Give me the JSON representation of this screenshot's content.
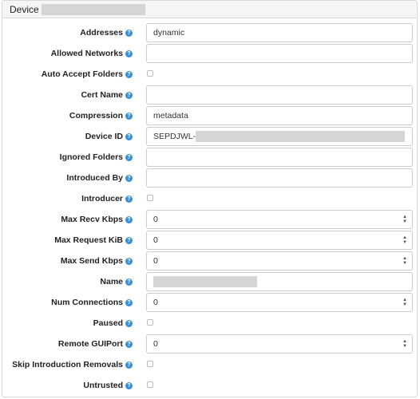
{
  "panel": {
    "title": "Device"
  },
  "rows": [
    {
      "label": "Addresses",
      "value": "dynamic"
    },
    {
      "label": "Allowed Networks",
      "value": ""
    },
    {
      "label": "Auto Accept Folders",
      "checked": false
    },
    {
      "label": "Cert Name",
      "value": ""
    },
    {
      "label": "Compression",
      "value": "metadata"
    },
    {
      "label": "Device ID",
      "value": "SEPDJWL-"
    },
    {
      "label": "Ignored Folders",
      "value": ""
    },
    {
      "label": "Introduced By",
      "value": ""
    },
    {
      "label": "Introducer",
      "checked": false
    },
    {
      "label": "Max Recv Kbps",
      "value": "0"
    },
    {
      "label": "Max Request KiB",
      "value": "0"
    },
    {
      "label": "Max Send Kbps",
      "value": "0"
    },
    {
      "label": "Name",
      "value": ""
    },
    {
      "label": "Num Connections",
      "value": "0"
    },
    {
      "label": "Paused",
      "checked": false
    },
    {
      "label": "Remote GUIPort",
      "value": "0"
    },
    {
      "label": "Skip Introduction Removals",
      "checked": false
    },
    {
      "label": "Untrusted",
      "checked": false
    }
  ],
  "icons": {
    "help": "question-circle-icon",
    "stepper": "up-down-chevron-icon"
  },
  "colors": {
    "help_icon": "#3a8fd6",
    "border": "#cccccc",
    "header_bg": "#f5f5f5"
  }
}
